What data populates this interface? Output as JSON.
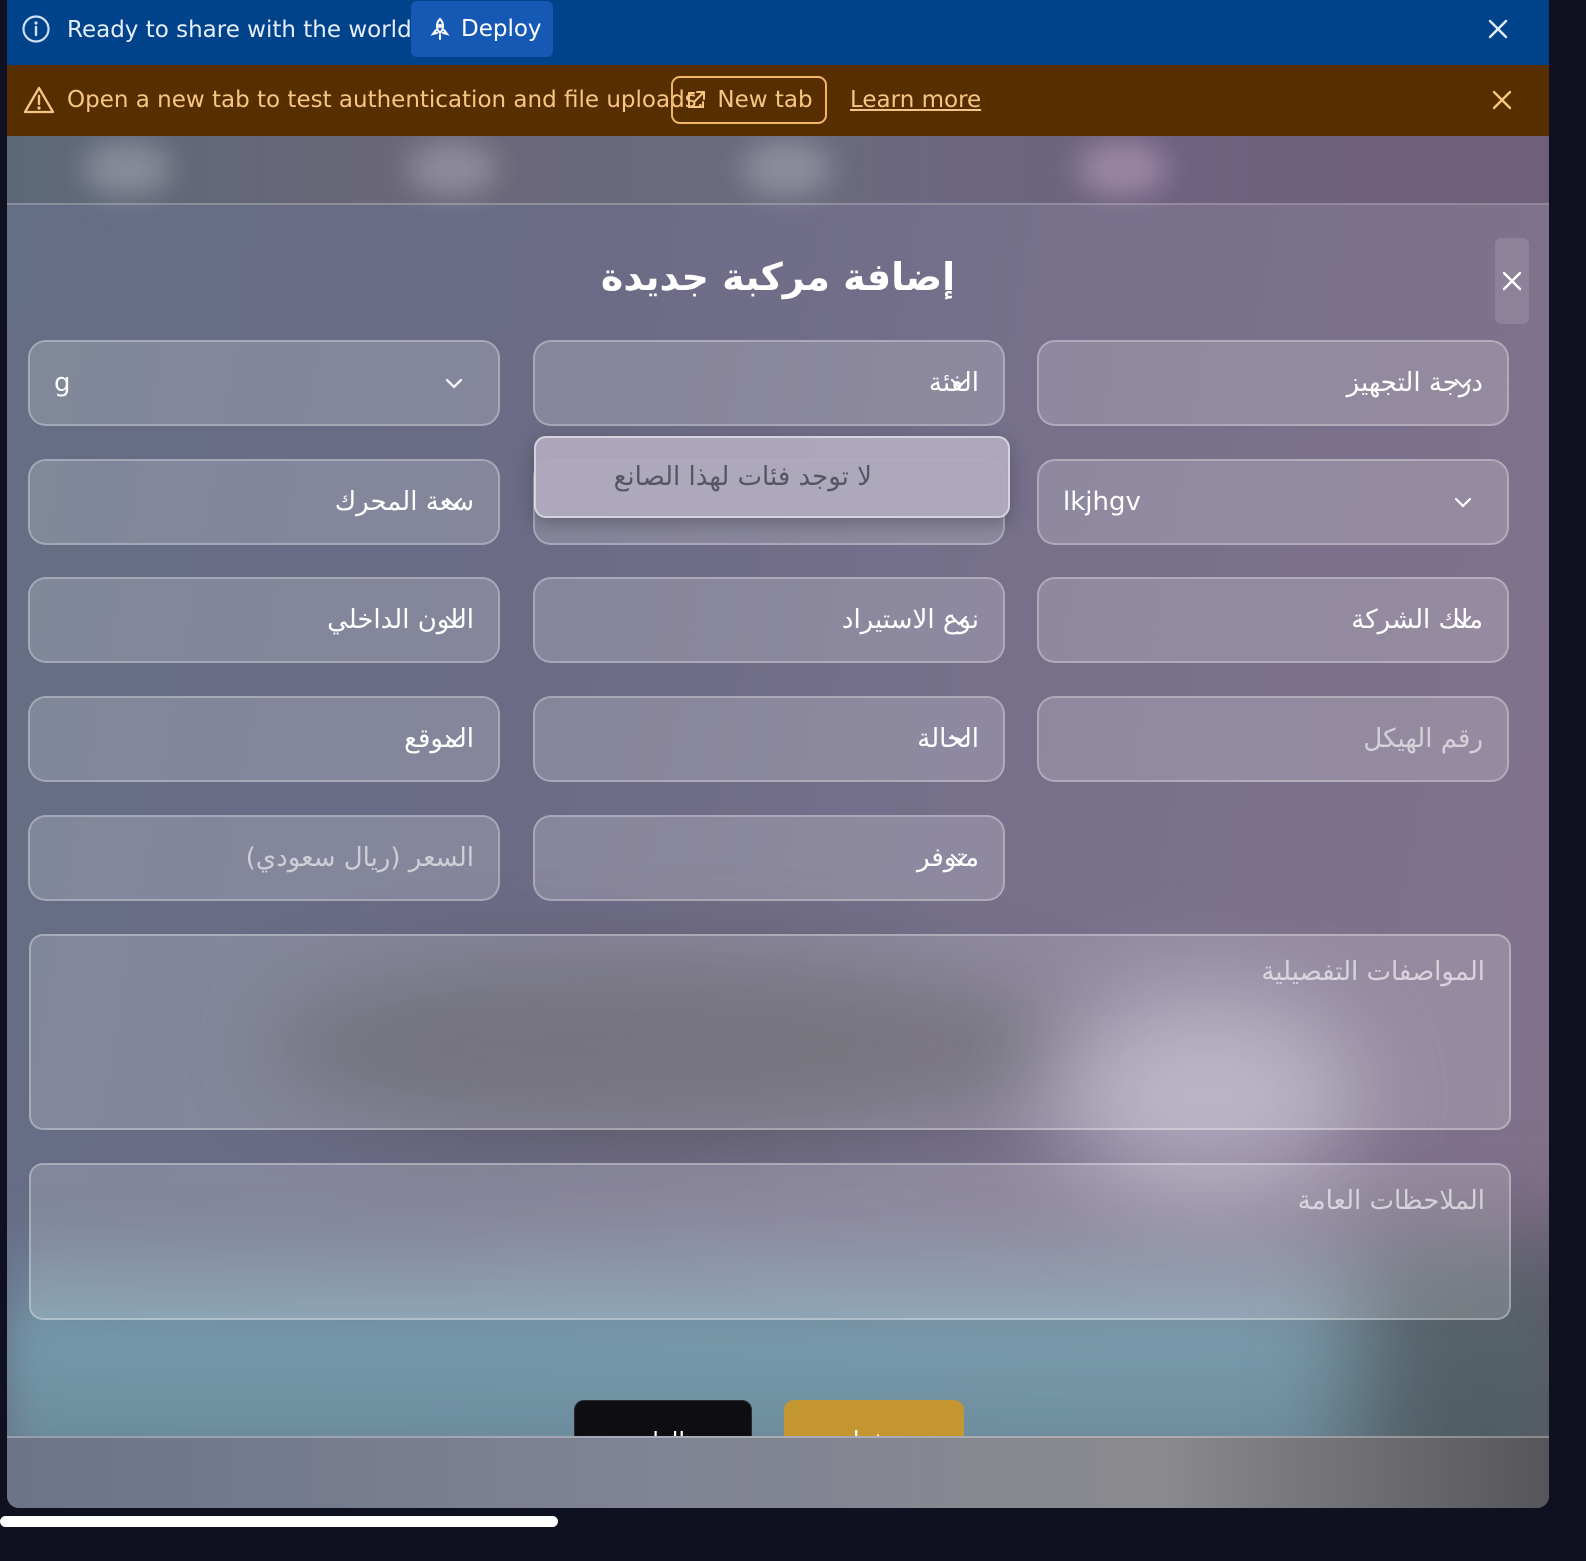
{
  "deploy_banner": {
    "message": "Ready to share with the world?",
    "deploy_label": "Deploy"
  },
  "warning_banner": {
    "message": "Open a new tab to test authentication and file uploads.",
    "new_tab_label": "New tab",
    "learn_more_label": "Learn more"
  },
  "modal": {
    "title": "إضافة مركبة جديدة",
    "fields": {
      "trim_level": "درجة التجهيز",
      "category": "الفئة",
      "row1_left": "g",
      "row2_right": "lkjhgv",
      "engine_capacity": "سعة المحرك",
      "company_owned": "ملك الشركة",
      "import_type": "نوع الاستيراد",
      "interior_color": "اللون الداخلي",
      "chassis_number_placeholder": "رقم الهيكل",
      "status": "الحالة",
      "location": "الموقع",
      "availability": "متوفر",
      "price_placeholder": "السعر (ريال سعودي)",
      "detailed_specs_placeholder": "المواصفات التفصيلية",
      "general_notes_placeholder": "الملاحظات العامة"
    },
    "category_dropdown": {
      "empty_message": "لا توجد فئات لهذا الصانع"
    },
    "buttons": {
      "cancel_label": "إلغاء",
      "save_label": "حفظ"
    }
  },
  "colors": {
    "deploy_banner_bg": "#00438a",
    "warning_banner_bg": "#572e00",
    "warning_text": "#f6c684",
    "save_button": "#c3962f",
    "cancel_button": "#0d0d12"
  },
  "icons": [
    "info-icon",
    "rocket-icon",
    "close-icon",
    "warning-icon",
    "external-link-icon",
    "chevron-down-icon"
  ]
}
